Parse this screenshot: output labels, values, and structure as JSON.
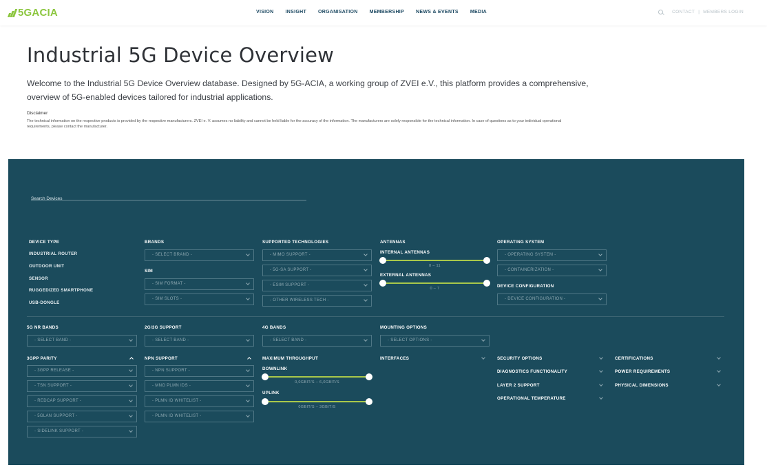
{
  "header": {
    "logo_text": "5GACIA",
    "nav": [
      "VISION",
      "INSIGHT",
      "ORGANISATION",
      "MEMBERSHIP",
      "NEWS & EVENTS",
      "MEDIA"
    ],
    "contact": "CONTACT",
    "separator": "|",
    "members_login": "MEMBERS LOGIN"
  },
  "intro": {
    "title": "Industrial 5G Device Overview",
    "text": "Welcome to the Industrial 5G Device Overview database. Designed by 5G-ACIA, a working group of ZVEI e.V., this platform provides a comprehensive, overview of 5G-enabled devices tailored for industrial applications.",
    "disclaimer_title": "Disclaimer",
    "disclaimer_text": "The technical information on the respective products is provided by the respective manufacturers. ZVEI e. V. assumes no liability and cannot be held liable for the accuracy of the information. The manufacturers are solely responsible for the technical information. In case of questions as to your individual operational requirements, please contact the manufacturer."
  },
  "filters": {
    "search_placeholder": "Search Devices",
    "device_type": {
      "label": "DEVICE TYPE",
      "items": [
        "INDUSTRIAL ROUTER",
        "OUTDOOR UNIT",
        "SENSOR",
        "RUGGEDIZED SMARTPHONE",
        "USB-DONGLE"
      ]
    },
    "brands": {
      "label": "BRANDS",
      "select": "- SELECT BRAND -"
    },
    "sim": {
      "label": "SIM",
      "format": "- SIM FORMAT -",
      "slots": "- SIM SLOTS -"
    },
    "supported_tech": {
      "label": "SUPPORTED TECHNOLOGIES",
      "mimo": "- MIMO SUPPORT -",
      "sa": "- 5G-SA SUPPORT -",
      "esim": "- ESIM SUPPORT -",
      "other": "- OTHER WIRELESS TECH -"
    },
    "antennas": {
      "label": "ANTENNAS",
      "internal_label": "INTERNAL ANTENNAS",
      "internal_range": "0 – 11",
      "internal_min_frac": 0,
      "internal_max_frac": 1,
      "external_label": "EXTERNAL ANTENNAS",
      "external_range": "0 – 7",
      "external_min_frac": 0,
      "external_max_frac": 1
    },
    "operating_system": {
      "label": "OPERATING SYSTEM",
      "os": "- OPERATING SYSTEM -",
      "container": "- CONTAINERIZATION -"
    },
    "device_configuration": {
      "label": "DEVICE CONFIGURATION",
      "select": "- DEVICE CONFIGURATION -"
    },
    "nr_bands": {
      "label": "5G NR BANDS",
      "select": "- SELECT BAND -"
    },
    "support_2g3g": {
      "label": "2G/3G SUPPORT",
      "select": "- SELECT BAND -"
    },
    "bands_4g": {
      "label": "4G BANDS",
      "select": "- SELECT BAND -"
    },
    "mounting": {
      "label": "MOUNTING OPTIONS",
      "select": "- SELECT OPTIONS -"
    },
    "parity": {
      "label": "3GPP PARITY",
      "release": "- 3GPP RELEASE -",
      "tsn": "- TSN SUPPORT -",
      "redcap": "- REDCAP SUPPORT -",
      "5glan": "- 5GLAN SUPPORT -",
      "sidelink": "- SIDELINK SUPPORT -"
    },
    "npn": {
      "label": "NPN SUPPORT",
      "npn": "- NPN SUPPORT -",
      "mno": "- MNO PLMN IDS -",
      "plmn1": "- PLMN ID WHITELIST -",
      "plmn2": "- PLMN ID WHITELIST -"
    },
    "throughput": {
      "label": "MAXIMUM THROUGHPUT",
      "downlink_label": "DOWNLINK",
      "downlink_range": "0,0GBIT/S – 6,0GBIT/S",
      "uplink_label": "UPLINK",
      "uplink_range": "0GBIT/S – 3GBIT/S",
      "min_frac": 0,
      "max_frac": 1
    },
    "interfaces": {
      "label": "INTERFACES"
    },
    "security": {
      "label": "SECURITY OPTIONS"
    },
    "diagnostics": {
      "label": "DIAGNOSTICS FUNCTIONALITY"
    },
    "layer2": {
      "label": "LAYER 2 SUPPORT"
    },
    "op_temp": {
      "label": "OPERATIONAL TEMPERATURE"
    },
    "certifications": {
      "label": "CERTIFICATIONS"
    },
    "power": {
      "label": "POWER REQUIREMENTS"
    },
    "dimensions": {
      "label": "PHYSICAL DIMENSIONS"
    }
  },
  "colors": {
    "panel": "#1b4b5c",
    "accent": "#8cc63f",
    "slider": "#a9c84a"
  }
}
